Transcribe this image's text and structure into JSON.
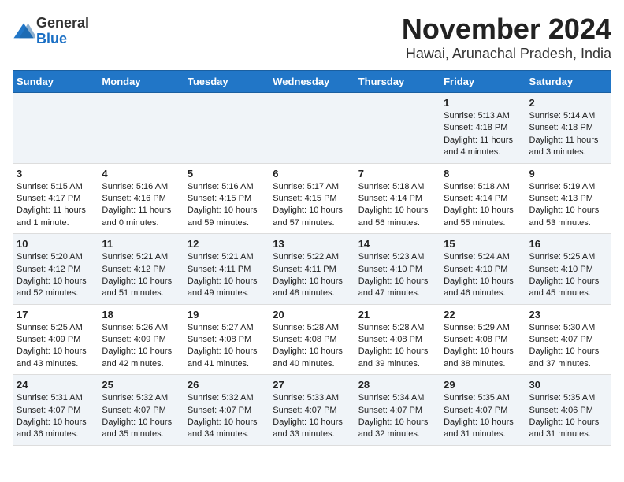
{
  "header": {
    "logo": {
      "general": "General",
      "blue": "Blue"
    },
    "title": "November 2024",
    "subtitle": "Hawai, Arunachal Pradesh, India"
  },
  "columns": [
    "Sunday",
    "Monday",
    "Tuesday",
    "Wednesday",
    "Thursday",
    "Friday",
    "Saturday"
  ],
  "weeks": [
    [
      {
        "day": "",
        "info": ""
      },
      {
        "day": "",
        "info": ""
      },
      {
        "day": "",
        "info": ""
      },
      {
        "day": "",
        "info": ""
      },
      {
        "day": "",
        "info": ""
      },
      {
        "day": "1",
        "info": "Sunrise: 5:13 AM\nSunset: 4:18 PM\nDaylight: 11 hours\nand 4 minutes."
      },
      {
        "day": "2",
        "info": "Sunrise: 5:14 AM\nSunset: 4:18 PM\nDaylight: 11 hours\nand 3 minutes."
      }
    ],
    [
      {
        "day": "3",
        "info": "Sunrise: 5:15 AM\nSunset: 4:17 PM\nDaylight: 11 hours\nand 1 minute."
      },
      {
        "day": "4",
        "info": "Sunrise: 5:16 AM\nSunset: 4:16 PM\nDaylight: 11 hours\nand 0 minutes."
      },
      {
        "day": "5",
        "info": "Sunrise: 5:16 AM\nSunset: 4:15 PM\nDaylight: 10 hours\nand 59 minutes."
      },
      {
        "day": "6",
        "info": "Sunrise: 5:17 AM\nSunset: 4:15 PM\nDaylight: 10 hours\nand 57 minutes."
      },
      {
        "day": "7",
        "info": "Sunrise: 5:18 AM\nSunset: 4:14 PM\nDaylight: 10 hours\nand 56 minutes."
      },
      {
        "day": "8",
        "info": "Sunrise: 5:18 AM\nSunset: 4:14 PM\nDaylight: 10 hours\nand 55 minutes."
      },
      {
        "day": "9",
        "info": "Sunrise: 5:19 AM\nSunset: 4:13 PM\nDaylight: 10 hours\nand 53 minutes."
      }
    ],
    [
      {
        "day": "10",
        "info": "Sunrise: 5:20 AM\nSunset: 4:12 PM\nDaylight: 10 hours\nand 52 minutes."
      },
      {
        "day": "11",
        "info": "Sunrise: 5:21 AM\nSunset: 4:12 PM\nDaylight: 10 hours\nand 51 minutes."
      },
      {
        "day": "12",
        "info": "Sunrise: 5:21 AM\nSunset: 4:11 PM\nDaylight: 10 hours\nand 49 minutes."
      },
      {
        "day": "13",
        "info": "Sunrise: 5:22 AM\nSunset: 4:11 PM\nDaylight: 10 hours\nand 48 minutes."
      },
      {
        "day": "14",
        "info": "Sunrise: 5:23 AM\nSunset: 4:10 PM\nDaylight: 10 hours\nand 47 minutes."
      },
      {
        "day": "15",
        "info": "Sunrise: 5:24 AM\nSunset: 4:10 PM\nDaylight: 10 hours\nand 46 minutes."
      },
      {
        "day": "16",
        "info": "Sunrise: 5:25 AM\nSunset: 4:10 PM\nDaylight: 10 hours\nand 45 minutes."
      }
    ],
    [
      {
        "day": "17",
        "info": "Sunrise: 5:25 AM\nSunset: 4:09 PM\nDaylight: 10 hours\nand 43 minutes."
      },
      {
        "day": "18",
        "info": "Sunrise: 5:26 AM\nSunset: 4:09 PM\nDaylight: 10 hours\nand 42 minutes."
      },
      {
        "day": "19",
        "info": "Sunrise: 5:27 AM\nSunset: 4:08 PM\nDaylight: 10 hours\nand 41 minutes."
      },
      {
        "day": "20",
        "info": "Sunrise: 5:28 AM\nSunset: 4:08 PM\nDaylight: 10 hours\nand 40 minutes."
      },
      {
        "day": "21",
        "info": "Sunrise: 5:28 AM\nSunset: 4:08 PM\nDaylight: 10 hours\nand 39 minutes."
      },
      {
        "day": "22",
        "info": "Sunrise: 5:29 AM\nSunset: 4:08 PM\nDaylight: 10 hours\nand 38 minutes."
      },
      {
        "day": "23",
        "info": "Sunrise: 5:30 AM\nSunset: 4:07 PM\nDaylight: 10 hours\nand 37 minutes."
      }
    ],
    [
      {
        "day": "24",
        "info": "Sunrise: 5:31 AM\nSunset: 4:07 PM\nDaylight: 10 hours\nand 36 minutes."
      },
      {
        "day": "25",
        "info": "Sunrise: 5:32 AM\nSunset: 4:07 PM\nDaylight: 10 hours\nand 35 minutes."
      },
      {
        "day": "26",
        "info": "Sunrise: 5:32 AM\nSunset: 4:07 PM\nDaylight: 10 hours\nand 34 minutes."
      },
      {
        "day": "27",
        "info": "Sunrise: 5:33 AM\nSunset: 4:07 PM\nDaylight: 10 hours\nand 33 minutes."
      },
      {
        "day": "28",
        "info": "Sunrise: 5:34 AM\nSunset: 4:07 PM\nDaylight: 10 hours\nand 32 minutes."
      },
      {
        "day": "29",
        "info": "Sunrise: 5:35 AM\nSunset: 4:07 PM\nDaylight: 10 hours\nand 31 minutes."
      },
      {
        "day": "30",
        "info": "Sunrise: 5:35 AM\nSunset: 4:06 PM\nDaylight: 10 hours\nand 31 minutes."
      }
    ]
  ]
}
